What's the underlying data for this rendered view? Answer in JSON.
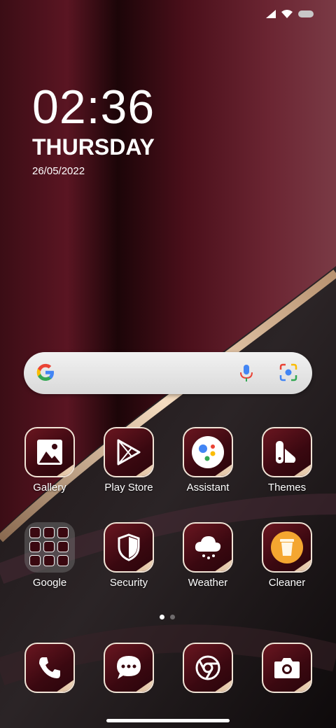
{
  "status": {
    "signal_icon": "signal-icon",
    "wifi_icon": "wifi-icon",
    "battery_icon": "battery-icon"
  },
  "clock": {
    "time": "02:36",
    "day": "THURSDAY",
    "date": "26/05/2022"
  },
  "search": {
    "google_icon": "google-g-icon",
    "mic_icon": "mic-icon",
    "lens_icon": "lens-icon"
  },
  "apps_row1": [
    {
      "label": "Gallery"
    },
    {
      "label": "Play Store"
    },
    {
      "label": "Assistant"
    },
    {
      "label": "Themes"
    }
  ],
  "apps_row2": [
    {
      "label": "Google"
    },
    {
      "label": "Security"
    },
    {
      "label": "Weather"
    },
    {
      "label": "Cleaner"
    }
  ],
  "dock": [
    "phone-icon",
    "messages-icon",
    "chrome-icon",
    "camera-icon"
  ],
  "colors": {
    "tile_bg": "#3a0810",
    "tile_border": "#f1e4d6",
    "accent_gold": "#d9b896"
  }
}
